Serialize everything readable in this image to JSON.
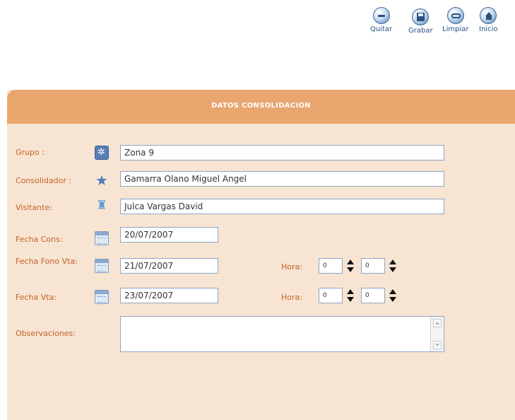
{
  "toolbar": {
    "quitar": "Quitar",
    "grabar": "Grabar",
    "limpiar": "Limpiar",
    "inicio": "Inicio"
  },
  "panel": {
    "title": "DATOS CONSOLIDACION"
  },
  "form": {
    "grupo": {
      "label": "Grupo :",
      "value": "Zona 9",
      "icon": "group-icon"
    },
    "consolidador": {
      "label": "Consolidador :",
      "value": "Gamarra Olano Miguel Angel",
      "icon": "star-icon"
    },
    "visitante": {
      "label": "Visitante:",
      "value": "Julca Vargas David",
      "icon": "person-icon"
    },
    "fecha_cons": {
      "label": "Fecha Cons:",
      "value": "20/07/2007",
      "icon": "calendar-icon"
    },
    "fecha_fono": {
      "label": "Fecha Fono Vta:",
      "value": "21/07/2007",
      "icon": "calendar-icon",
      "hora_label": "Hora:",
      "hora": "0",
      "minuto": "0"
    },
    "fecha_vta": {
      "label": "Fecha Vta:",
      "value": "23/07/2007",
      "icon": "calendar-icon",
      "hora_label": "Hora:",
      "hora": "0",
      "minuto": "0"
    },
    "observaciones": {
      "label": "Observaciones:",
      "value": ""
    }
  },
  "colors": {
    "header": "#e9a66e",
    "panel_bg": "#f7e4d2",
    "label": "#c4622a",
    "toolbar_text": "#2a4f86"
  }
}
